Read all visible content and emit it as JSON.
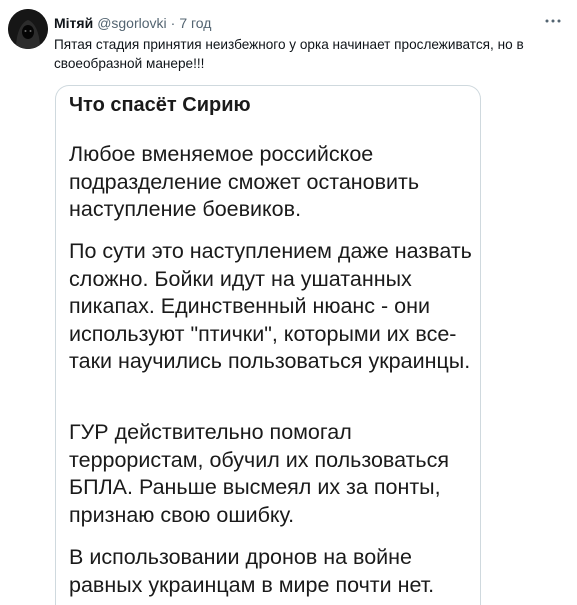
{
  "tweet": {
    "author_name": "Мітяй",
    "handle": "@sgorlovki",
    "separator": "·",
    "time": "7 год",
    "text": "Пятая стадия принятия неизбежного у орка начинает прослеживатся, но в своеобразной манере!!!"
  },
  "media": {
    "title": "Что спасёт Сирию",
    "paragraphs": [
      "Любое вменяемое российское подразделение сможет остановить наступление боевиков.",
      "По сути это наступлением даже назвать сложно. Бойки идут на ушатанных пикапах. Единственный нюанс - они используют \"птички\", которыми их все-таки научились пользоваться украинцы.",
      "ГУР действительно помогал террористам, обучил их пользоваться БПЛА. Раньше высмеял их за понты, признаю свою ошибку.",
      "В использовании дронов на войне равных украинцам в мире почти нет."
    ]
  },
  "icons": {
    "avatar": "hooded-figure-avatar",
    "more": "more-icon"
  },
  "colors": {
    "text": "#0f1419",
    "secondary": "#536471",
    "border": "#cfd9de"
  }
}
